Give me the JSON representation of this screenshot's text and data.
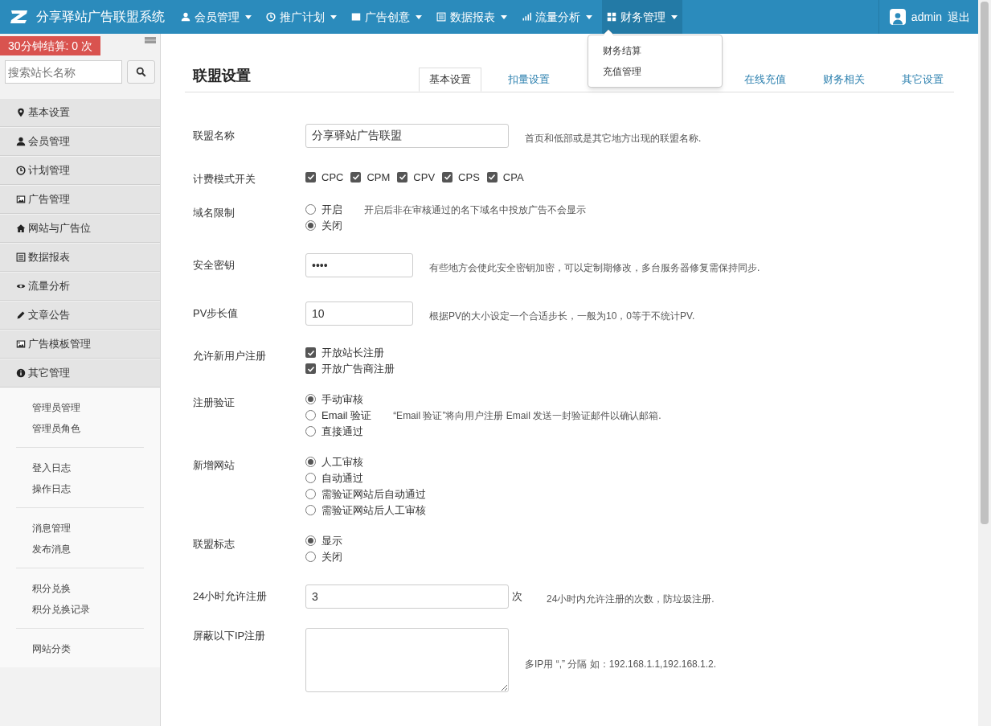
{
  "header": {
    "brand": "分享驿站广告联盟系统",
    "menus": [
      {
        "label": "会员管理",
        "open": false
      },
      {
        "label": "推广计划",
        "open": false
      },
      {
        "label": "广告创意",
        "open": false
      },
      {
        "label": "数据报表",
        "open": false
      },
      {
        "label": "流量分析",
        "open": false
      },
      {
        "label": "财务管理",
        "open": true
      }
    ],
    "user": "admin",
    "logout": "退出"
  },
  "dropdown": {
    "items": [
      "财务结算",
      "充值管理"
    ]
  },
  "sidebar": {
    "badge": "30分钟结算: 0 次",
    "search": {
      "placeholder": "搜索站长名称"
    },
    "items": [
      {
        "label": "基本设置"
      },
      {
        "label": "会员管理"
      },
      {
        "label": "计划管理"
      },
      {
        "label": "广告管理"
      },
      {
        "label": "网站与广告位"
      },
      {
        "label": "数据报表"
      },
      {
        "label": "流量分析"
      },
      {
        "label": "文章公告"
      },
      {
        "label": "广告模板管理"
      },
      {
        "label": "其它管理",
        "groups": [
          [
            "管理员管理",
            "管理员角色"
          ],
          [
            "登入日志",
            "操作日志"
          ],
          [
            "消息管理",
            "发布消息"
          ],
          [
            "积分兑换",
            "积分兑换记录"
          ],
          [
            "网站分类"
          ]
        ]
      }
    ]
  },
  "content": {
    "title": "联盟设置",
    "tabs": [
      {
        "label": "基本设置",
        "selected": true
      },
      {
        "label": "扣量设置",
        "selected": false
      },
      {
        "label": "在线充值",
        "selected": false
      },
      {
        "label": "财务相关",
        "selected": false
      },
      {
        "label": "其它设置",
        "selected": false
      }
    ],
    "form": [
      {
        "label": "联盟名称",
        "kind": "text",
        "value": "分享驿站广告联盟",
        "help": "首页和低部或是其它地方出现的联盟名称."
      },
      {
        "label": "计费模式开关",
        "kind": "checks",
        "options": [
          {
            "label": "CPC",
            "checked": true
          },
          {
            "label": "CPM",
            "checked": true
          },
          {
            "label": "CPV",
            "checked": true
          },
          {
            "label": "CPS",
            "checked": true
          },
          {
            "label": "CPA",
            "checked": true
          }
        ]
      },
      {
        "label": "域名限制",
        "kind": "radios",
        "options": [
          {
            "label": "开启",
            "selected": false,
            "note": "开启后非在审核通过的名下域名中投放广告不会显示"
          },
          {
            "label": "关闭",
            "selected": true
          }
        ]
      },
      {
        "label": "安全密钥",
        "kind": "short",
        "value": "••••",
        "help": "有些地方会使此安全密钥加密，可以定制期修改，多台服务器修复需保持同步."
      },
      {
        "label": "PV步长值",
        "kind": "short",
        "value": "10",
        "help": "根据PV的大小设定一个合适步长，一般为10，0等于不统计PV."
      },
      {
        "label": "允许新用户注册",
        "kind": "checklist",
        "options": [
          {
            "label": "开放站长注册",
            "checked": true
          },
          {
            "label": "开放广告商注册",
            "checked": true
          }
        ]
      },
      {
        "label": "注册验证",
        "kind": "radios",
        "options": [
          {
            "label": "手动审核",
            "selected": true
          },
          {
            "label": "Email 验证",
            "selected": false,
            "note": "“Email 验证”将向用户注册 Email 发送一封验证邮件以确认邮箱."
          },
          {
            "label": "直接通过",
            "selected": false
          }
        ]
      },
      {
        "label": "新增网站",
        "kind": "radios",
        "options": [
          {
            "label": "人工审核",
            "selected": true
          },
          {
            "label": "自动通过",
            "selected": false
          },
          {
            "label": "需验证网站后自动通过",
            "selected": false
          },
          {
            "label": "需验证网站后人工审核",
            "selected": false
          }
        ]
      },
      {
        "label": "联盟标志",
        "kind": "radios",
        "options": [
          {
            "label": "显示",
            "selected": true
          },
          {
            "label": "关闭",
            "selected": false
          }
        ]
      },
      {
        "label": "24小时允许注册",
        "kind": "text",
        "value": "3",
        "suffix": "次",
        "help": "24小时内允许注册的次数，防垃圾注册."
      },
      {
        "label": "屏蔽以下IP注册",
        "kind": "textarea",
        "help": "多IP用 “,” 分隔 如：192.168.1.1,192.168.1.2."
      }
    ]
  }
}
